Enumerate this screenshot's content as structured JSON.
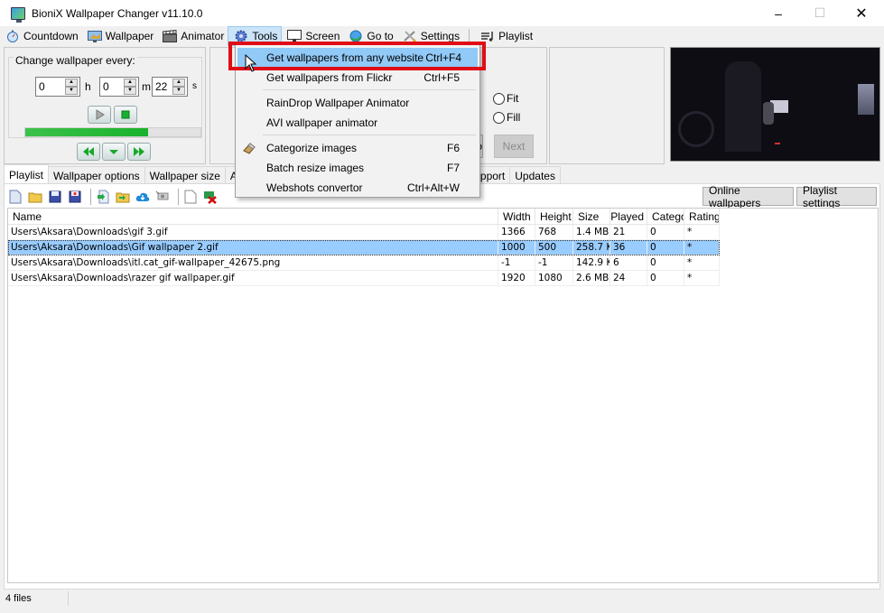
{
  "window": {
    "title": "BioniX Wallpaper Changer v11.10.0",
    "minimize": "–",
    "maximize": "☐",
    "close": "✕"
  },
  "menubar": {
    "items": [
      {
        "label": "Countdown",
        "icon": "stopwatch-icon"
      },
      {
        "label": "Wallpaper",
        "icon": "wallpaper-icon"
      },
      {
        "label": "Animator",
        "icon": "clapperboard-icon"
      },
      {
        "label": "Tools",
        "icon": "gear-icon",
        "active": true
      },
      {
        "label": "Screen",
        "icon": "monitor-icon"
      },
      {
        "label": "Go to",
        "icon": "globe-icon"
      },
      {
        "label": "Settings",
        "icon": "tools-icon"
      },
      {
        "label": "Playlist",
        "icon": "playlist-icon"
      }
    ]
  },
  "timer": {
    "group_label": "Change wallpaper every:",
    "hours": "0",
    "minutes": "0",
    "seconds": "22",
    "unit_h": "h",
    "unit_m": "m",
    "unit_s": "s",
    "progress_percent": 70
  },
  "wallpaper_fit": {
    "options": [
      "Fit",
      "Fill"
    ],
    "prev_partial": "o",
    "next_label": "Next"
  },
  "tools_menu": {
    "items": [
      {
        "label": "Get wallpapers from any website",
        "shortcut": "Ctrl+F4",
        "highlighted": true
      },
      {
        "label": "Get wallpapers from Flickr",
        "shortcut": "Ctrl+F5"
      },
      {
        "label": "RainDrop Wallpaper Animator",
        "shortcut": ""
      },
      {
        "label": "AVI wallpaper animator",
        "shortcut": ""
      },
      {
        "label": "Categorize images",
        "shortcut": "F6",
        "icon": "eraser-icon"
      },
      {
        "label": "Batch resize images",
        "shortcut": "F7"
      },
      {
        "label": "Webshots convertor",
        "shortcut": "Ctrl+Alt+W"
      }
    ]
  },
  "tabs": [
    {
      "label": "Playlist",
      "active": true
    },
    {
      "label": "Wallpaper options"
    },
    {
      "label": "Wallpaper size"
    },
    {
      "label": "Auto"
    },
    {
      "label": "pport"
    },
    {
      "label": "Updates"
    }
  ],
  "playlist_toolbar": {
    "online_wallpapers": "Online wallpapers",
    "playlist_settings": "Playlist settings"
  },
  "playlist": {
    "columns": [
      "Name",
      "Width",
      "Height",
      "Size",
      "Played",
      "Catego",
      "Rating"
    ],
    "rows": [
      {
        "name": "Users\\Aksara\\Downloads\\gif 3.gif",
        "width": "1366",
        "height": "768",
        "size": "1.4 MB",
        "played": "21",
        "category": "0",
        "rating": "*"
      },
      {
        "name": "Users\\Aksara\\Downloads\\Gif wallpaper 2.gif",
        "width": "1000",
        "height": "500",
        "size": "258.7 KI",
        "played": "36",
        "category": "0",
        "rating": "*",
        "selected": true
      },
      {
        "name": "Users\\Aksara\\Downloads\\itl.cat_gif-wallpaper_42675.png",
        "width": "-1",
        "height": "-1",
        "size": "142.9 KI",
        "played": "6",
        "category": "0",
        "rating": "*"
      },
      {
        "name": "Users\\Aksara\\Downloads\\razer gif wallpaper.gif",
        "width": "1920",
        "height": "1080",
        "size": "2.6 MB",
        "played": "24",
        "category": "0",
        "rating": "*"
      }
    ]
  },
  "status": {
    "files": "4 files"
  }
}
